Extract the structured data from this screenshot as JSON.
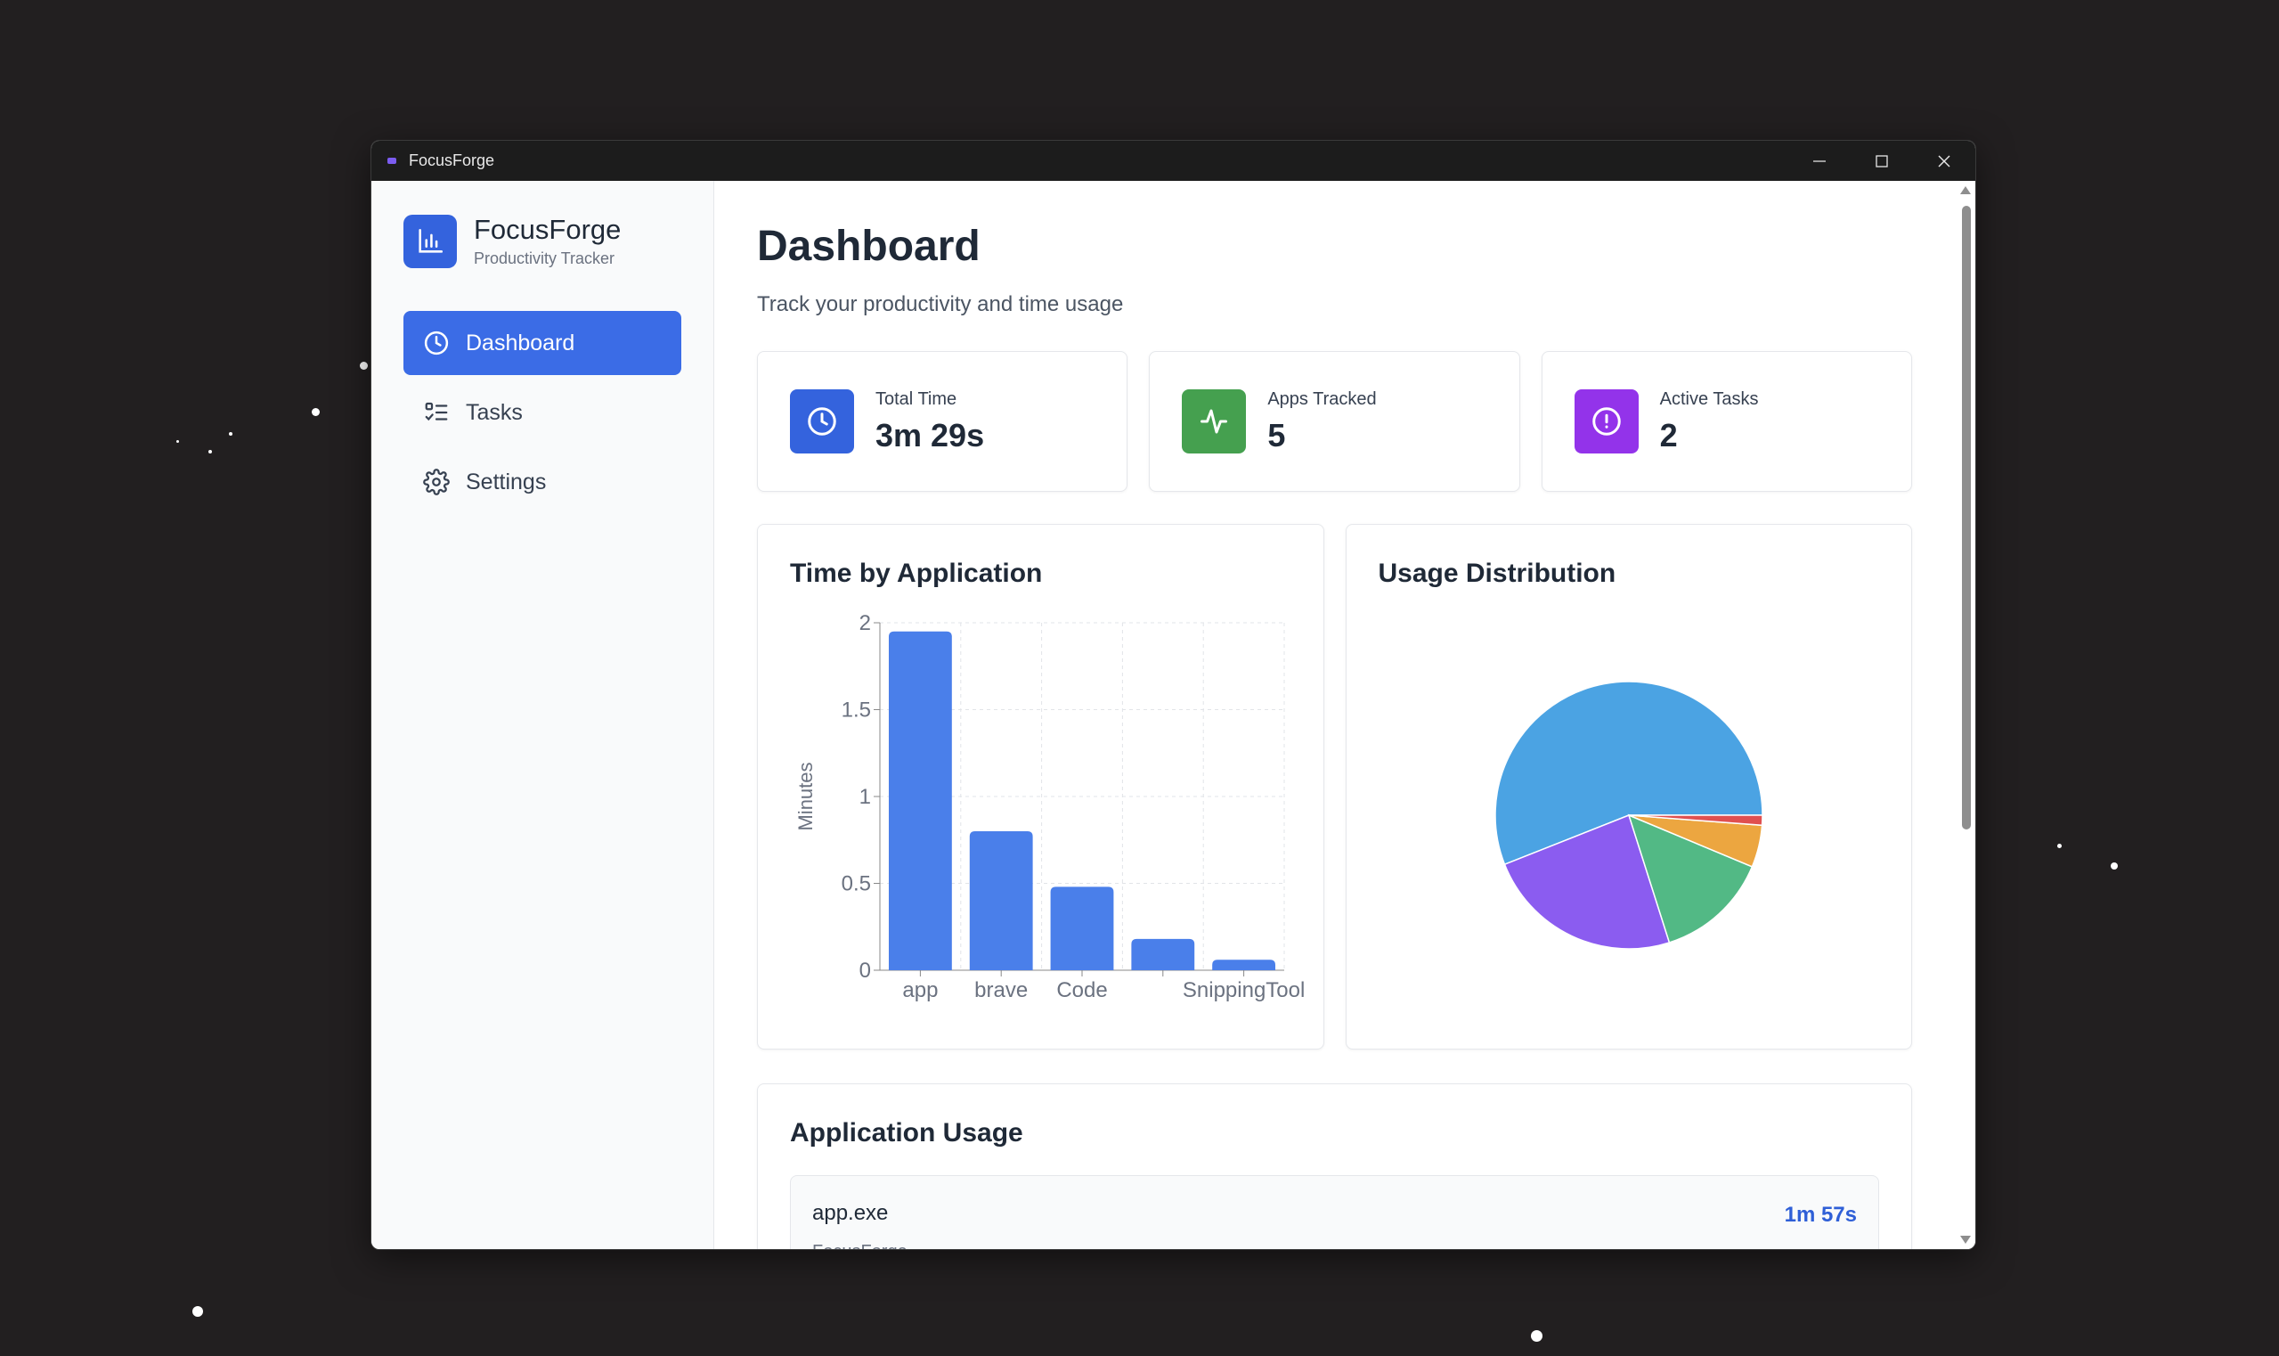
{
  "window": {
    "title": "FocusForge"
  },
  "sidebar": {
    "brand_name": "FocusForge",
    "brand_sub": "Productivity Tracker",
    "items": [
      {
        "label": "Dashboard",
        "icon": "clock-icon",
        "active": true
      },
      {
        "label": "Tasks",
        "icon": "checklist-icon",
        "active": false
      },
      {
        "label": "Settings",
        "icon": "gear-icon",
        "active": false
      }
    ]
  },
  "header": {
    "title": "Dashboard",
    "subtitle": "Track your productivity and time usage"
  },
  "stats": [
    {
      "label": "Total Time",
      "value": "3m 29s",
      "icon": "clock-icon",
      "color": "#3463dd"
    },
    {
      "label": "Apps Tracked",
      "value": "5",
      "icon": "activity-icon",
      "color": "#45a04f"
    },
    {
      "label": "Active Tasks",
      "value": "2",
      "icon": "alert-circle-icon",
      "color": "#9333ea"
    }
  ],
  "bar_title": "Time by Application",
  "pie_title": "Usage Distribution",
  "chart_data": [
    {
      "type": "bar",
      "title": "Time by Application",
      "categories": [
        "app",
        "brave",
        "Code",
        "",
        "SnippingTool"
      ],
      "values": [
        1.95,
        0.8,
        0.48,
        0.18,
        0.06
      ],
      "ylabel": "Minutes",
      "yticks": [
        "0",
        "0.5",
        "1",
        "1.5",
        "2"
      ],
      "ylim": [
        0,
        2
      ],
      "grid": true,
      "color": "#4a7fea"
    },
    {
      "type": "pie",
      "title": "Usage Distribution",
      "values": [
        0.56,
        0.239,
        0.138,
        0.051,
        0.012
      ],
      "colors": [
        "#4ba3e3",
        "#8b5cf0",
        "#52b985",
        "#eca640",
        "#e05050"
      ]
    }
  ],
  "usage": {
    "title": "Application Usage",
    "items": [
      {
        "name": "app.exe",
        "time": "1m 57s",
        "sub": "FocusForge"
      }
    ]
  }
}
